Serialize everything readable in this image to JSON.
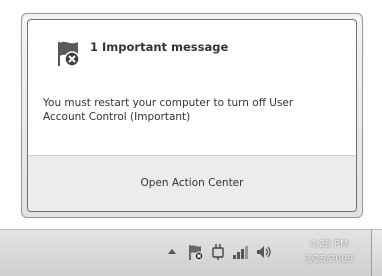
{
  "notification": {
    "title": "1 Important message",
    "message": "You must restart your computer to turn off User Account Control (Important)",
    "footer_link": "Open Action Center"
  },
  "taskbar": {
    "clock_time": "4:29 PM",
    "clock_date": "3/25/2009",
    "tray_icons": [
      "chevron-up-icon",
      "action-center-flag-icon",
      "power-plug-icon",
      "network-signal-icon",
      "volume-icon"
    ]
  }
}
